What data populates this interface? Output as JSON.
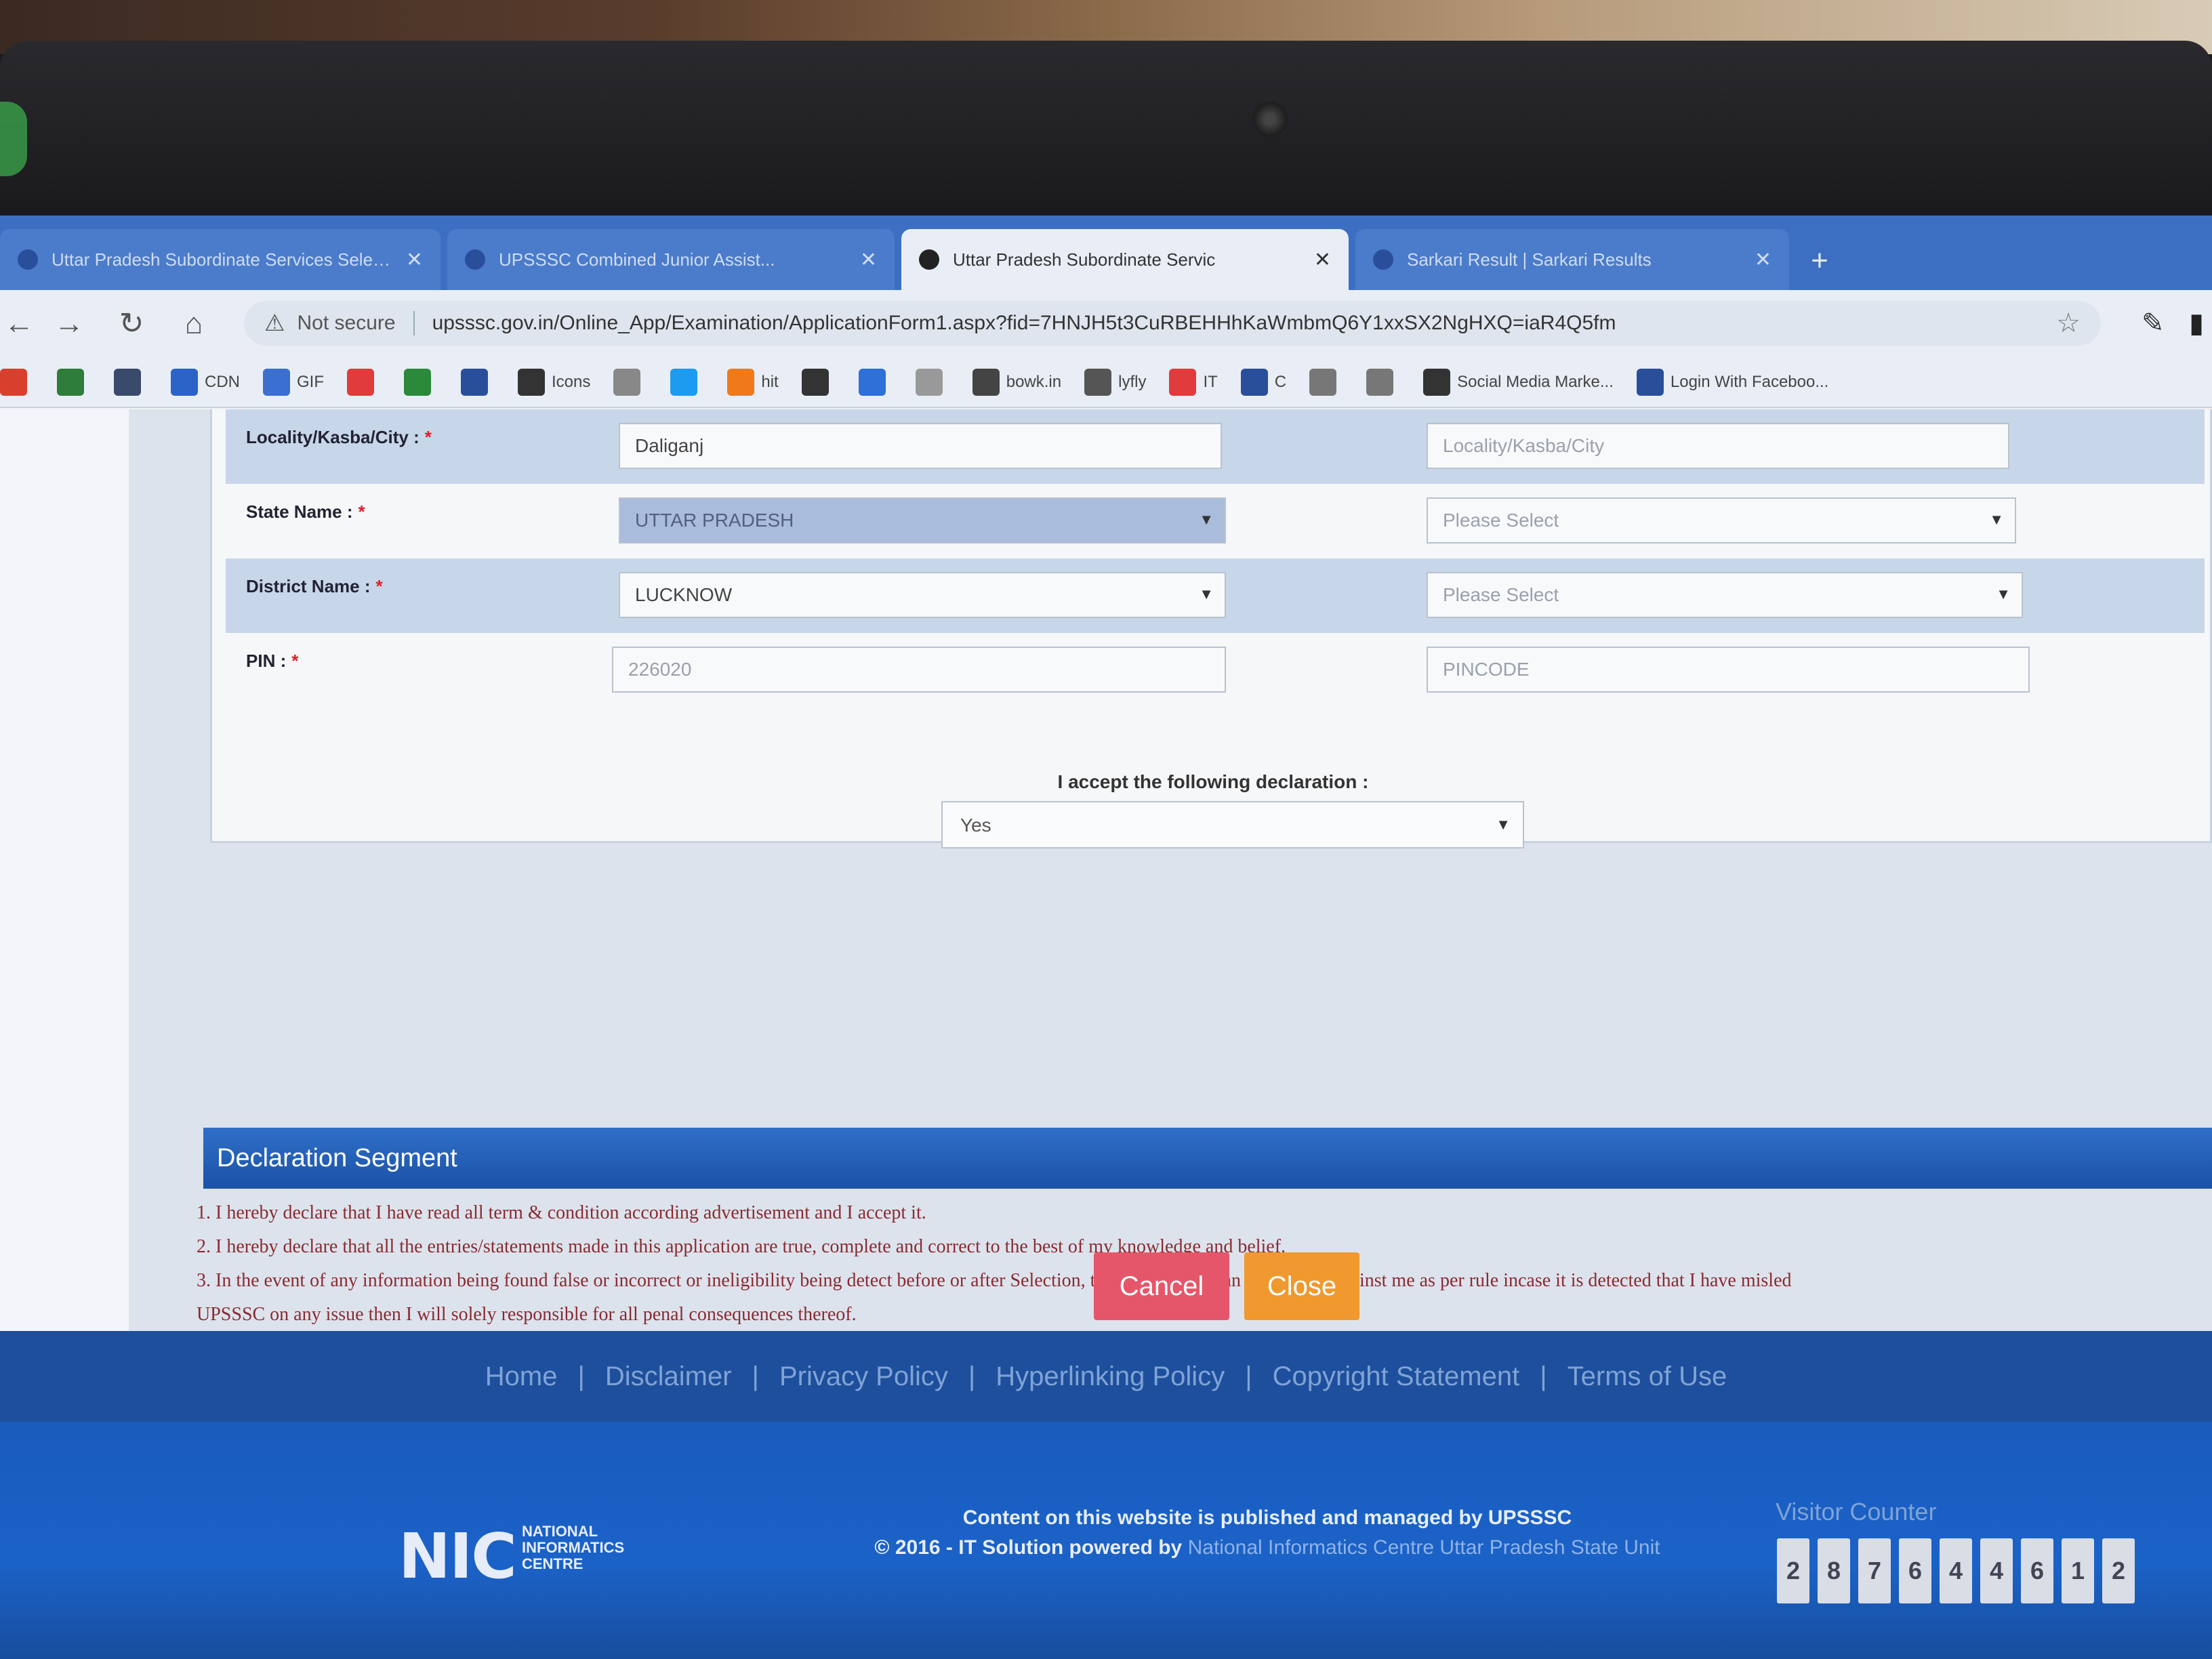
{
  "browser": {
    "tabs": [
      {
        "label": "Uttar Pradesh Subordinate Services Selection ...",
        "active": false
      },
      {
        "label": "UPSSSC Combined Junior Assist...",
        "active": false
      },
      {
        "label": "Uttar Pradesh Subordinate Servic",
        "active": true
      },
      {
        "label": "Sarkari Result | Sarkari Results",
        "active": false
      }
    ],
    "security_label": "Not secure",
    "url": "upsssc.gov.in/Online_App/Examination/ApplicationForm1.aspx?fid=7HNJH5t3CuRBEHHhKaWmbmQ6Y1xxSX2NgHXQ=iaR4Q5fm",
    "bookmarks": [
      {
        "label": "",
        "color": "#d8402e"
      },
      {
        "label": "",
        "color": "#2e7d3a"
      },
      {
        "label": "",
        "color": "#3a4a6a"
      },
      {
        "label": "CDN",
        "color": "#2b63c8"
      },
      {
        "label": "GIF",
        "color": "#3b6fd0"
      },
      {
        "label": "",
        "color": "#e23b3b"
      },
      {
        "label": "",
        "color": "#2a8a3a"
      },
      {
        "label": "",
        "color": "#2a4f9a"
      },
      {
        "label": "Icons",
        "color": "#333333"
      },
      {
        "label": "",
        "color": "#888888"
      },
      {
        "label": "",
        "color": "#1d9bf0"
      },
      {
        "label": "hit",
        "color": "#f07a1a"
      },
      {
        "label": "",
        "color": "#333333"
      },
      {
        "label": "",
        "color": "#2e6fd8"
      },
      {
        "label": "",
        "color": "#999999"
      },
      {
        "label": "bowk.in",
        "color": "#444444"
      },
      {
        "label": "lyfly",
        "color": "#555555"
      },
      {
        "label": "IT",
        "color": "#e23b3b"
      },
      {
        "label": "C",
        "color": "#2a4f9a"
      },
      {
        "label": "",
        "color": "#777777"
      },
      {
        "label": "",
        "color": "#777777"
      },
      {
        "label": "Social Media Marke...",
        "color": "#333333"
      },
      {
        "label": "Login With Faceboo...",
        "color": "#2a4f9a"
      }
    ]
  },
  "form": {
    "rows": [
      {
        "label": "Locality/Kasba/City :",
        "value1": "Daliganj",
        "value1_kind": "text",
        "value2": "Locality/Kasba/City",
        "value2_kind": "placeholder",
        "is_select": false
      },
      {
        "label": "State Name :",
        "value1": "UTTAR PRADESH",
        "value1_kind": "selected",
        "value2": "Please Select",
        "value2_kind": "placeholder",
        "is_select": true
      },
      {
        "label": "District Name :",
        "value1": "LUCKNOW",
        "value1_kind": "text",
        "value2": "Please Select",
        "value2_kind": "placeholder",
        "is_select": true
      },
      {
        "label": "PIN :",
        "value1": "226020",
        "value1_kind": "placeholder",
        "value2": "PINCODE",
        "value2_kind": "placeholder",
        "is_select": false
      }
    ],
    "required_mark": "*",
    "declaration_prompt": "I accept the following declaration :",
    "declaration_value": "Yes"
  },
  "declaration": {
    "title": "Declaration Segment",
    "lines": [
      "1. I hereby declare that I have read all term & condition according advertisement and I accept it.",
      "2. I hereby declare that all the entries/statements made in this application are true, complete and correct to the best of my knowledge and belief.",
      "3. In the event of any information being found false or incorrect or ineligibility being detect before or after Selection, the commission can take action against me as per rule incase it is detected that I have misled",
      "UPSSSC on any issue then I will solely responsible for all penal consequences thereof."
    ]
  },
  "buttons": {
    "cancel": "Cancel",
    "close": "Close"
  },
  "footer": {
    "links": [
      "Home",
      "Disclaimer",
      "Privacy Policy",
      "Hyperlinking Policy",
      "Copyright Statement",
      "Terms of Use"
    ],
    "nic_logo": "NIC",
    "nic_subtitle": "NATIONAL INFORMATICS CENTRE",
    "credit_line1": "Content on this website is published and managed by UPSSSC",
    "credit_line2_prefix": "© 2016 - IT Solution powered by",
    "credit_line2_nic": "National Informatics Centre Uttar Pradesh State Unit",
    "visitor_label": "Visitor Counter",
    "visitor_digits": [
      "2",
      "8",
      "7",
      "6",
      "4",
      "4",
      "6",
      "1",
      "2"
    ]
  },
  "colors": {
    "accent": "#1b52a6",
    "cancel": "#e5566a",
    "close": "#f0992e",
    "required": "#e21d2a"
  }
}
